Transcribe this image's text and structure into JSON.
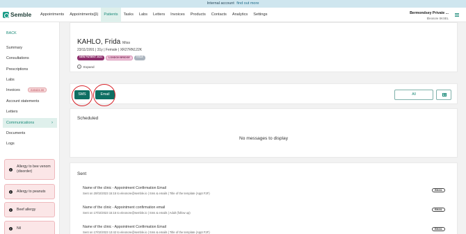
{
  "banner": {
    "text": "Internal account",
    "link": "find out more"
  },
  "app": {
    "name": "Semble"
  },
  "nav": {
    "items": [
      "Appointments",
      "Appointments(β)",
      "Patients",
      "Tasks",
      "Labs",
      "Letters",
      "Invoices",
      "Products",
      "Contacts",
      "Analytics",
      "Settings"
    ],
    "active": "Patients"
  },
  "account": {
    "practice": "Bermondsey Private ...",
    "user": "Eleonore SKSEL"
  },
  "sidebar": {
    "back": "BACK",
    "items": [
      "Summary",
      "Consultations",
      "Prescriptions",
      "Labs",
      "Invoices",
      "Account statements",
      "Letters",
      "Communications",
      "Documents",
      "Logs"
    ],
    "active": "Communications",
    "invoice_badge": "£40424.00",
    "allergies": [
      "Allergy to bee venom (disorder)",
      "Allergy to peanuts",
      "Beef allergy",
      "Nil"
    ]
  },
  "patient": {
    "name": "KAHLO, Frida",
    "title": "Miss",
    "dob": "23/11/1991",
    "age": "31y",
    "sex": "Female",
    "id": "XR27RN122K",
    "tags": [
      "NEW PATIENT 2021",
      "LONDON BRIDGE",
      "TITLE"
    ],
    "expand": "Expand"
  },
  "actions": {
    "sms": "SMS",
    "email": "Email",
    "filter": "All"
  },
  "scheduled": {
    "title": "Scheduled",
    "empty": "No messages to display"
  },
  "sent": {
    "title": "Sent",
    "messages": [
      {
        "title": "Name of the clinic - Appointment Confirmation Email",
        "meta": "Sent on 20/02/2023 15:15 to eleonore@semble.io | Sms & emails | Title of the template (Appt F2F)",
        "type": "EMAIL"
      },
      {
        "title": "Name of the clinic - Appointment confirmation email",
        "meta": "Sent on 17/02/2023 15:15 to eleonore@semble.io | Sms & emails | Adult (follow up)",
        "type": "EMAIL"
      },
      {
        "title": "Name of the clinic - Appointment Confirmation Email",
        "meta": "Sent on 17/02/2023 13:42 to eleonore@semble.io | Sms & emails | Title of the template (Appt F2F)",
        "type": "EMAIL"
      }
    ]
  }
}
